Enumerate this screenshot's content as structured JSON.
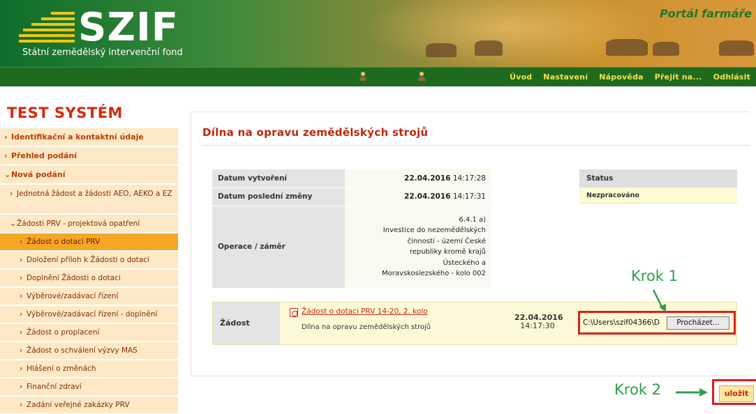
{
  "header": {
    "brand": "SZIF",
    "brand_sub": "Státní zemědělský intervenční fond",
    "portal": "Portál farmáře"
  },
  "nav": {
    "links": [
      "Úvod",
      "Nastavení",
      "Nápověda",
      "Přejít na...",
      "Odhlásit"
    ]
  },
  "sidebar": {
    "system_title": "TEST SYSTÉM",
    "items": [
      {
        "label": "Identifikační a kontaktní údaje",
        "level": 1
      },
      {
        "label": "Přehled podání",
        "level": 1
      },
      {
        "label": "Nová podání",
        "level": 1,
        "expanded": true
      },
      {
        "label": "Jednotná žádost a žádosti AEO, AEKO a EZ",
        "level": 2
      },
      {
        "label": "Žádosti PRV - projektová opatření",
        "level": 2,
        "expanded": true
      },
      {
        "label": "Žádost o dotaci PRV",
        "level": 3,
        "active": true
      },
      {
        "label": "Doložení příloh k Žádosti o dotaci",
        "level": 3
      },
      {
        "label": "Doplnění Žádosti o dotaci",
        "level": 3
      },
      {
        "label": "Výběrové/zadávací řízení",
        "level": 3
      },
      {
        "label": "Výběrové/zadávací řízení - doplnění",
        "level": 3
      },
      {
        "label": "Žádost o proplacení",
        "level": 3
      },
      {
        "label": "Žádost o schválení výzvy MAS",
        "level": 3
      },
      {
        "label": "Hlášení o změnách",
        "level": 3
      },
      {
        "label": "Finanční zdraví",
        "level": 3
      },
      {
        "label": "Zadání veřejné zakázky PRV",
        "level": 3
      }
    ]
  },
  "main": {
    "title": "Dílna na opravu zemědělských strojů",
    "info": {
      "created_label": "Datum vytvoření",
      "created_date": "22.04.2016",
      "created_time": "14:17:28",
      "changed_label": "Datum poslední změny",
      "changed_date": "22.04.2016",
      "changed_time": "14:17:31",
      "operation_label": "Operace / záměr",
      "operation_lines": [
        "6.4.1 a)",
        "Investice do nezemědělských",
        "činností - území České",
        "republiky kromě krajů",
        "Ústeckého a",
        "Moravskoslezského - kolo 002"
      ]
    },
    "status": {
      "header": "Status",
      "value": "Nezpracováno"
    },
    "request": {
      "label": "Žádost",
      "doc_link": "Žádost o dotaci PRV 14-20, 2. kolo",
      "doc_desc": "Dílna na opravu zemědělských strojů",
      "date": "22.04.2016",
      "time": "14:17:30",
      "file_value": "C:\\Users\\szif04366\\D",
      "browse_label": "Procházet..."
    },
    "save_label": "uložit"
  },
  "annotations": {
    "step1": "Krok 1",
    "step2": "Krok 2"
  },
  "colors": {
    "brand_green": "#1e6b1f",
    "accent_orange": "#f5a623",
    "title_red": "#c0260c",
    "highlight_red": "#e31b1b",
    "annotation_green": "#2aa14a"
  }
}
